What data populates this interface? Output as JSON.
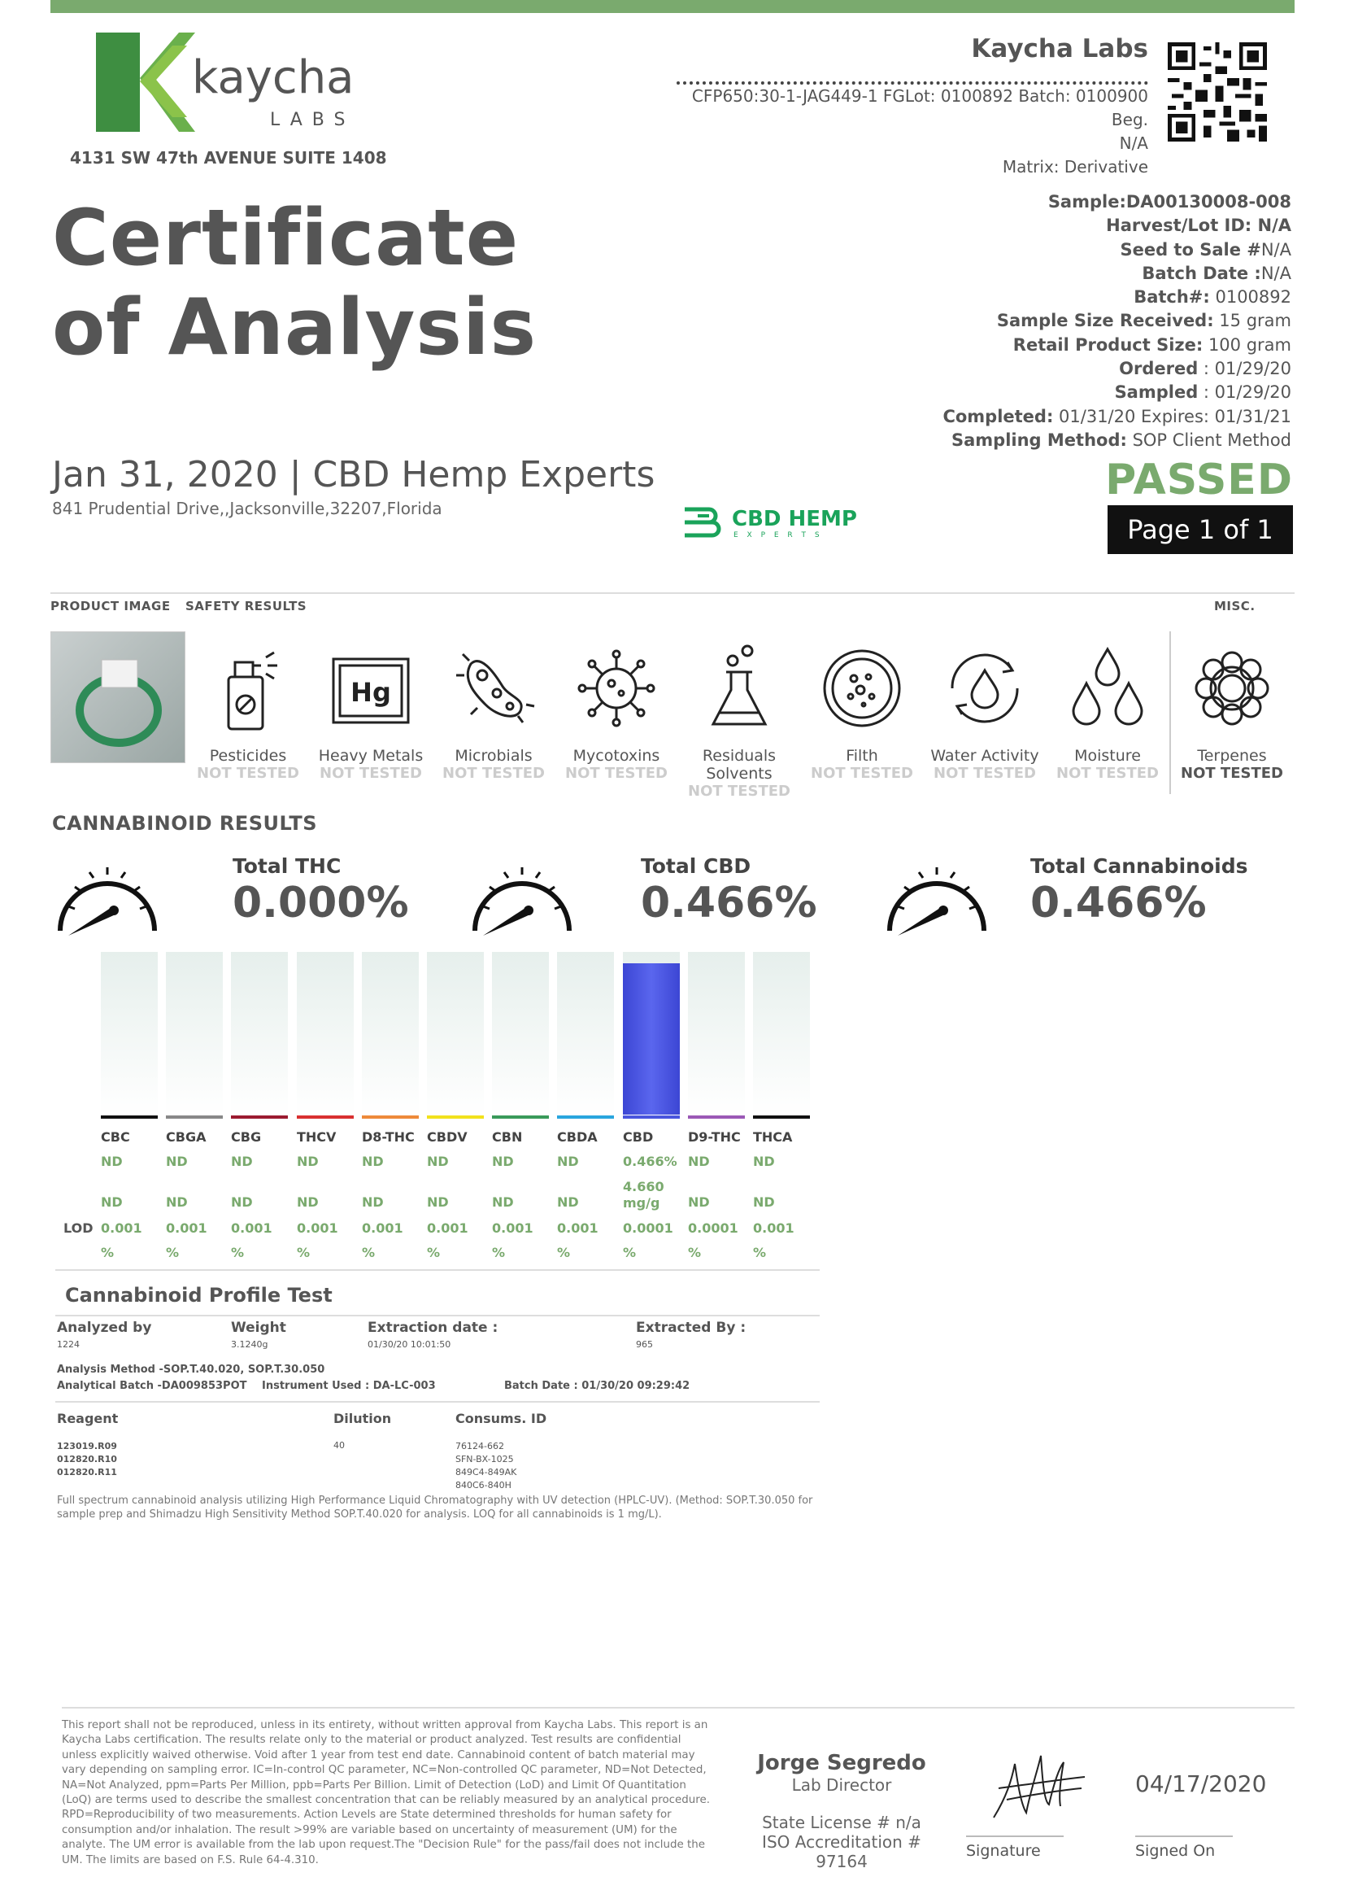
{
  "header": {
    "logo_text": "kaycha",
    "logo_sub": "LABS",
    "address": "4131 SW 47th AVENUE SUITE 1408",
    "lab_name": "Kaycha Labs",
    "batch_line1": "CFP650:30-1-JAG449-1 FGLot: 0100892 Batch: 0100900 Beg.",
    "batch_line2": "N/A",
    "matrix": "Matrix: Derivative"
  },
  "title": {
    "line1": "Certificate",
    "line2": "of Analysis",
    "date_client": "Jan 31, 2020 | CBD Hemp Experts",
    "client_address": "841 Prudential Drive,,Jacksonville,32207,Florida"
  },
  "meta": [
    {
      "label": "Sample:DA00130008-008",
      "value": ""
    },
    {
      "label": "Harvest/Lot ID: N/A",
      "value": ""
    },
    {
      "label": "Seed to Sale #",
      "value": "N/A"
    },
    {
      "label": "Batch Date :",
      "value": "N/A"
    },
    {
      "label": "Batch#:",
      "value": " 0100892"
    },
    {
      "label": "Sample Size Received:",
      "value": " 15 gram"
    },
    {
      "label": "Retail Product Size:",
      "value": " 100 gram"
    },
    {
      "label": "Ordered",
      "value": " : 01/29/20"
    },
    {
      "label": "Sampled",
      "value": " : 01/29/20"
    },
    {
      "label": "Completed:",
      "value": " 01/31/20 Expires: 01/31/21"
    },
    {
      "label": "Sampling Method:",
      "value": " SOP Client Method"
    }
  ],
  "status": {
    "result": "PASSED",
    "page": "Page 1 of 1"
  },
  "client_logo": {
    "main": "CBD HEMP",
    "sub": "E X P E R T S"
  },
  "sections": {
    "product_image": "PRODUCT IMAGE",
    "safety_results": "SAFETY RESULTS",
    "misc": "MISC.",
    "cannabinoid_results": "CANNABINOID RESULTS"
  },
  "safety": [
    {
      "name": "Pesticides",
      "status": "NOT TESTED",
      "icon": "spray-bottle-icon"
    },
    {
      "name": "Heavy Metals",
      "status": "NOT TESTED",
      "icon": "hg-element-icon"
    },
    {
      "name": "Microbials",
      "status": "NOT TESTED",
      "icon": "microbe-icon"
    },
    {
      "name": "Mycotoxins",
      "status": "NOT TESTED",
      "icon": "virus-icon"
    },
    {
      "name": "Residuals Solvents",
      "status": "NOT TESTED",
      "icon": "flask-icon"
    },
    {
      "name": "Filth",
      "status": "NOT TESTED",
      "icon": "petri-dish-icon"
    },
    {
      "name": "Water Activity",
      "status": "NOT TESTED",
      "icon": "water-cycle-icon"
    },
    {
      "name": "Moisture",
      "status": "NOT TESTED",
      "icon": "droplets-icon"
    },
    {
      "name": "Terpenes",
      "status": "NOT TESTED",
      "icon": "flower-icon"
    }
  ],
  "totals": [
    {
      "label": "Total THC",
      "value": "0.000%"
    },
    {
      "label": "Total CBD",
      "value": "0.466%"
    },
    {
      "label": "Total Cannabinoids",
      "value": "0.466%"
    }
  ],
  "chart_data": {
    "type": "bar",
    "categories": [
      "CBC",
      "CBGA",
      "CBG",
      "THCV",
      "D8-THC",
      "CBDV",
      "CBN",
      "CBDA",
      "CBD",
      "D9-THC",
      "THCA"
    ],
    "values": [
      0,
      0,
      0,
      0,
      0,
      0,
      0,
      0,
      0.466,
      0,
      0
    ],
    "colors": [
      "#111111",
      "#888888",
      "#9b1b30",
      "#d93030",
      "#ee8a3a",
      "#f2e21c",
      "#3a9a5a",
      "#2aa6de",
      "#4a55dd",
      "#9b59b6",
      "#111111"
    ],
    "row_percent": [
      "ND",
      "ND",
      "ND",
      "ND",
      "ND",
      "ND",
      "ND",
      "ND",
      "0.466%",
      "ND",
      "ND"
    ],
    "row_mg": [
      "ND",
      "ND",
      "ND",
      "ND",
      "ND",
      "ND",
      "ND",
      "ND",
      "4.660 mg/g",
      "ND",
      "ND"
    ],
    "lod_values": [
      "0.001",
      "0.001",
      "0.001",
      "0.001",
      "0.001",
      "0.001",
      "0.001",
      "0.001",
      "0.0001",
      "0.0001",
      "0.001"
    ],
    "lod_unit": "%",
    "lod_label": "LOD"
  },
  "profile": {
    "title": "Cannabinoid Profile Test",
    "analyzed_by_label": "Analyzed by",
    "analyzed_by": "1224",
    "weight_label": "Weight",
    "weight": "3.1240g",
    "extraction_date_label": "Extraction date :",
    "extraction_date": "01/30/20 10:01:50",
    "extracted_by_label": "Extracted By :",
    "extracted_by": "965",
    "analysis_method": "Analysis Method -SOP.T.40.020, SOP.T.30.050",
    "analytical_batch": "Analytical Batch -DA009853POT",
    "instrument": "Instrument Used : DA-LC-003",
    "batch_date": "Batch Date : 01/30/20 09:29:42",
    "reagent_label": "Reagent",
    "dilution_label": "Dilution",
    "consums_label": "Consums. ID",
    "reagents": [
      "123019.R09",
      "012820.R10",
      "012820.R11"
    ],
    "dilution": "40",
    "consums": [
      "76124-662",
      "SFN-BX-1025",
      "849C4-849AK",
      "840C6-840H"
    ],
    "note": "Full spectrum cannabinoid analysis utilizing High Performance Liquid Chromatography with UV detection (HPLC-UV). (Method: SOP.T.30.050 for sample prep and Shimadzu High Sensitivity Method SOP.T.40.020 for analysis. LOQ for all cannabinoids is 1 mg/L)."
  },
  "footer": {
    "disclaimer": "This report shall not be reproduced, unless in its entirety, without written approval from Kaycha Labs. This report is an Kaycha Labs certification. The results relate only to the material or product analyzed. Test results are confidential unless explicitly waived otherwise. Void after 1 year from test end date. Cannabinoid content of batch material may vary depending on sampling error. IC=In-control QC parameter, NC=Non-controlled QC parameter, ND=Not Detected, NA=Not Analyzed, ppm=Parts Per Million, ppb=Parts Per Billion. Limit of Detection (LoD) and Limit Of Quantitation (LoQ) are terms used to describe the smallest concentration that can be reliably measured by an analytical procedure. RPD=Reproducibility of two measurements. Action Levels are State determined thresholds for human safety for consumption and/or inhalation. The result >99% are variable based on uncertainty of measurement (UM) for the analyte. The UM error is available from the lab upon request.The \"Decision Rule\" for the pass/fail does not include the UM. The limits are based on F.S. Rule 64-4.310.",
    "director_name": "Jorge Segredo",
    "director_role": "Lab Director",
    "license": "State License # n/a",
    "accreditation": "ISO Accreditation # 97164",
    "signature_label": "Signature",
    "signed_on_label": "Signed On",
    "signed_date": "04/17/2020"
  }
}
